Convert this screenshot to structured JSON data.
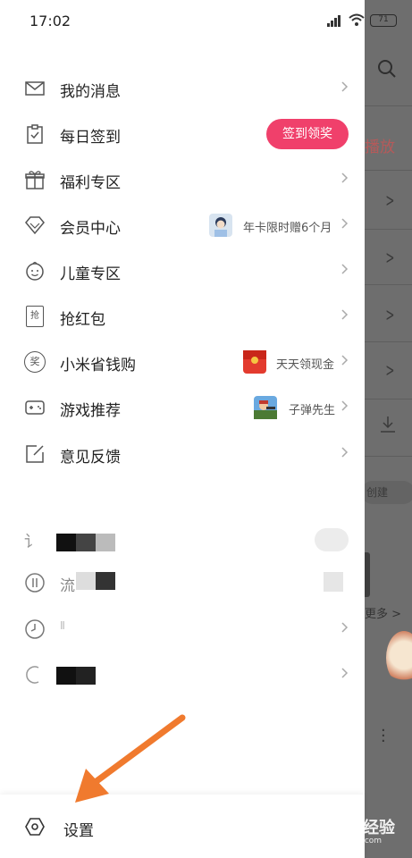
{
  "status_bar": {
    "time": "17:02",
    "battery": "71"
  },
  "menu": {
    "items": [
      {
        "label": "我的消息",
        "icon": "envelope-icon"
      },
      {
        "label": "每日签到",
        "icon": "clipboard-check-icon",
        "button": "签到领奖"
      },
      {
        "label": "福利专区",
        "icon": "gift-icon"
      },
      {
        "label": "会员中心",
        "icon": "diamond-icon",
        "side_text": "年卡限时赠6个月"
      },
      {
        "label": "儿童专区",
        "icon": "smiley-face-icon"
      },
      {
        "label": "抢红包",
        "icon": "red-envelope-icon",
        "icon_char": "抢"
      },
      {
        "label": "小米省钱购",
        "icon": "reward-coin-icon",
        "icon_char": "奖",
        "side_text": "天天领现金"
      },
      {
        "label": "游戏推荐",
        "icon": "gamepad-icon",
        "side_text": "子弹先生"
      },
      {
        "label": "意见反馈",
        "icon": "feedback-edit-icon"
      }
    ],
    "blurred_items": [
      {
        "icon_char": "讠"
      },
      {
        "label": "流"
      },
      {
        "label": "Ⅱ"
      },
      {
        "label": ""
      }
    ]
  },
  "settings": {
    "label": "设置",
    "icon": "hexagon-settings-icon"
  },
  "background": {
    "play_text": "播放",
    "create_text": "创建",
    "more_text": "更多 >"
  },
  "watermark": {
    "main": "Baidu 经验",
    "sub": "jingyan.baidu.com"
  },
  "colors": {
    "accent": "#f0406b",
    "arrow": "#f07a2e",
    "overlay": "#6e6e6e"
  }
}
